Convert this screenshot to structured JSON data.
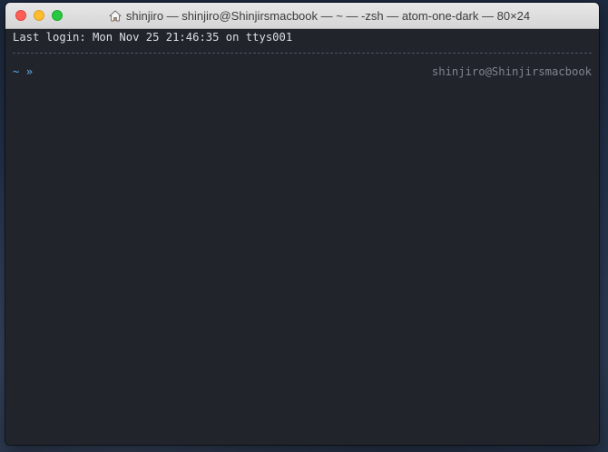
{
  "window": {
    "title": "shinjiro — shinjiro@Shinjirsmacbook — ~ — -zsh — atom-one-dark — 80×24",
    "title_icon": "home-icon",
    "controls": {
      "close": "close-button",
      "minimize": "minimize-button",
      "zoom": "zoom-button"
    }
  },
  "terminal": {
    "login_line": "Last login: Mon Nov 25 21:46:35 on ttys001",
    "prompt_dir": "~",
    "prompt_char": "»",
    "right_prompt": "shinjiro@Shinjirsmacbook"
  },
  "colors": {
    "background": "#21252b",
    "foreground": "#dcdfe4",
    "prompt": "#61afef",
    "right_prompt": "#7f848e",
    "close": "#fe5f57",
    "minimize": "#febc2e",
    "zoom": "#28c840"
  }
}
